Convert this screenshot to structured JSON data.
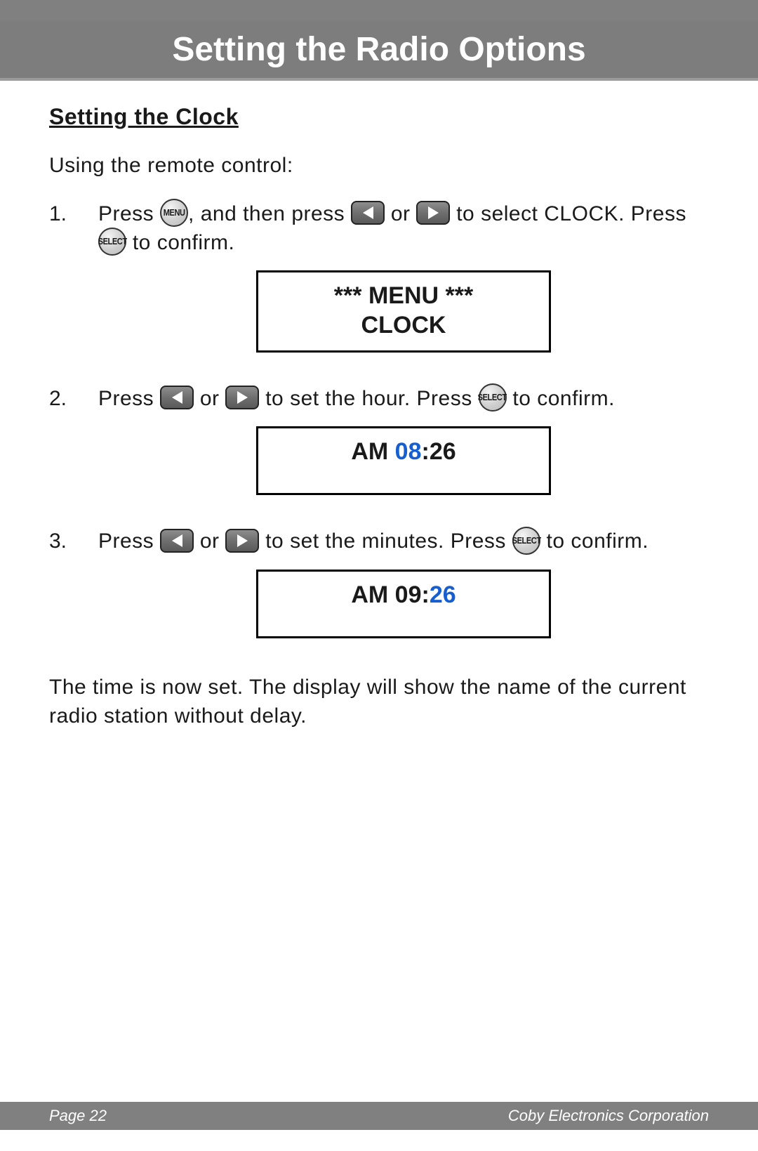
{
  "header": {
    "title": "Setting the Radio Options"
  },
  "section": {
    "heading": "Setting the Clock",
    "intro": "Using the remote control:"
  },
  "icons": {
    "menu": "MENU",
    "select": "SELECT",
    "left": "◄",
    "right": "►"
  },
  "steps": [
    {
      "num": "1.",
      "text_parts": {
        "a": "Press ",
        "b": ", and then press ",
        "c": " or ",
        "d": " to select CLOCK. Press ",
        "e": " to confirm."
      },
      "display": {
        "line1": "*** MENU ***",
        "line2": "CLOCK"
      }
    },
    {
      "num": "2.",
      "text_parts": {
        "a": "Press ",
        "b": " or ",
        "c": " to set the hour. Press ",
        "d": " to confirm."
      },
      "display": {
        "ampm": "AM  ",
        "hour": "08",
        "sep": ":",
        "min": "26"
      }
    },
    {
      "num": "3.",
      "text_parts": {
        "a": "Press ",
        "b": " or ",
        "c": " to set the minutes. Press ",
        "d": " to confirm."
      },
      "display": {
        "ampm": "AM  ",
        "hour": "09",
        "sep": ":",
        "min": "26"
      }
    }
  ],
  "closing": "The time is now set.  The display will show the name of the current radio station without delay.",
  "footer": {
    "page": "Page 22",
    "company": "Coby Electronics Corporation"
  }
}
